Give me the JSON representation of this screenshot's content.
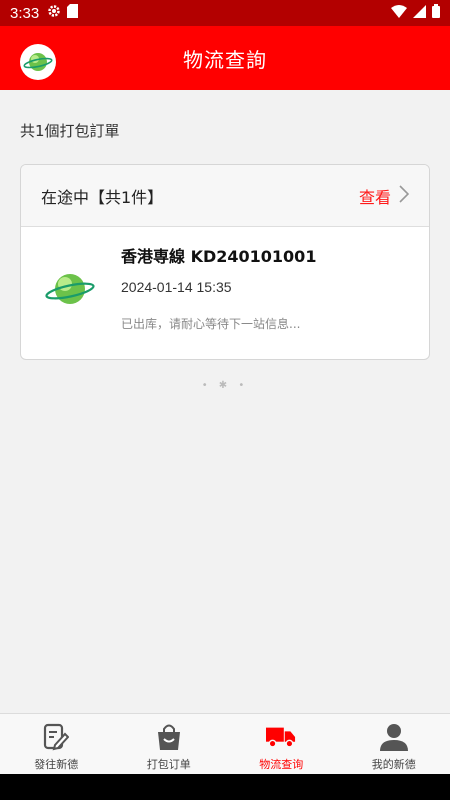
{
  "status_bar": {
    "time": "3:33"
  },
  "header": {
    "title": "物流查詢"
  },
  "summary": {
    "text": "共1個打包訂單"
  },
  "order_card": {
    "status": "在途中【共1件】",
    "view_label": "查看",
    "name": "香港専線 KD240101001",
    "date": "2024-01-14 15:35",
    "message": "已出库，请耐心等待下一站信息..."
  },
  "loader": {
    "text": "• ✱ •"
  },
  "tabs": [
    {
      "label": "發往新德",
      "icon": "edit-document-icon"
    },
    {
      "label": "打包订单",
      "icon": "shopping-bag-icon"
    },
    {
      "label": "物流查询",
      "icon": "truck-icon",
      "active": true
    },
    {
      "label": "我的新德",
      "icon": "person-icon"
    }
  ],
  "colors": {
    "primary": "#ff0000",
    "status_bar": "#b30000",
    "accent_text": "#ff1a1a"
  }
}
